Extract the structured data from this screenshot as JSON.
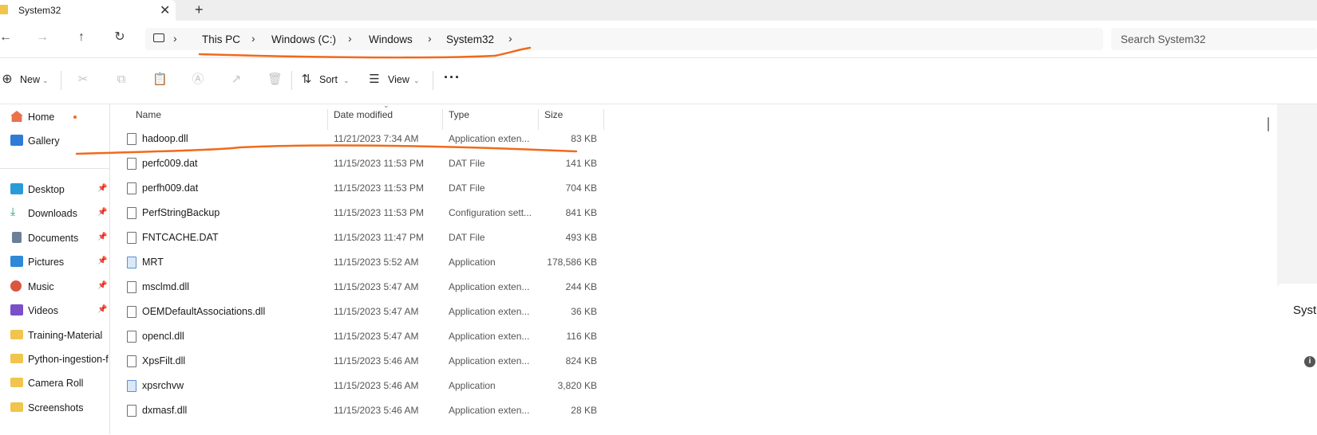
{
  "tab": {
    "title": "System32",
    "close": "✕",
    "new_tab": "+"
  },
  "nav": {
    "back": "←",
    "forward": "→",
    "up": "↑",
    "refresh": "↻",
    "breadcrumbs": [
      "This PC",
      "Windows (C:)",
      "Windows",
      "System32"
    ],
    "search_placeholder": "Search System32"
  },
  "commands": {
    "new_label": "New",
    "sort_label": "Sort",
    "view_label": "View",
    "more": "···"
  },
  "sidebar": {
    "items": [
      {
        "label": "Home",
        "icon": "home-icon"
      },
      {
        "label": "Gallery",
        "icon": "gallery-icon"
      },
      {
        "label": "Desktop",
        "icon": "desktop-icon",
        "pinned": true
      },
      {
        "label": "Downloads",
        "icon": "download-icon",
        "pinned": true
      },
      {
        "label": "Documents",
        "icon": "documents-icon",
        "pinned": true
      },
      {
        "label": "Pictures",
        "icon": "pictures-icon",
        "pinned": true
      },
      {
        "label": "Music",
        "icon": "music-icon",
        "pinned": true
      },
      {
        "label": "Videos",
        "icon": "videos-icon",
        "pinned": true
      },
      {
        "label": "Training-Material",
        "icon": "folder-icon"
      },
      {
        "label": "Python-ingestion-f",
        "icon": "folder-icon"
      },
      {
        "label": "Camera Roll",
        "icon": "folder-icon"
      },
      {
        "label": "Screenshots",
        "icon": "folder-icon"
      }
    ]
  },
  "columns": {
    "name": "Name",
    "date": "Date modified",
    "type": "Type",
    "size": "Size"
  },
  "files": [
    {
      "name": "hadoop.dll",
      "date": "11/21/2023 7:34 AM",
      "type": "Application exten...",
      "size": "83 KB",
      "icon": "dll-file-icon"
    },
    {
      "name": "perfc009.dat",
      "date": "11/15/2023 11:53 PM",
      "type": "DAT File",
      "size": "141 KB",
      "icon": "file-icon"
    },
    {
      "name": "perfh009.dat",
      "date": "11/15/2023 11:53 PM",
      "type": "DAT File",
      "size": "704 KB",
      "icon": "file-icon"
    },
    {
      "name": "PerfStringBackup",
      "date": "11/15/2023 11:53 PM",
      "type": "Configuration sett...",
      "size": "841 KB",
      "icon": "config-file-icon"
    },
    {
      "name": "FNTCACHE.DAT",
      "date": "11/15/2023 11:47 PM",
      "type": "DAT File",
      "size": "493 KB",
      "icon": "file-icon"
    },
    {
      "name": "MRT",
      "date": "11/15/2023 5:52 AM",
      "type": "Application",
      "size": "178,586 KB",
      "icon": "app-icon"
    },
    {
      "name": "msclmd.dll",
      "date": "11/15/2023 5:47 AM",
      "type": "Application exten...",
      "size": "244 KB",
      "icon": "dll-file-icon"
    },
    {
      "name": "OEMDefaultAssociations.dll",
      "date": "11/15/2023 5:47 AM",
      "type": "Application exten...",
      "size": "36 KB",
      "icon": "dll-file-icon"
    },
    {
      "name": "opencl.dll",
      "date": "11/15/2023 5:47 AM",
      "type": "Application exten...",
      "size": "116 KB",
      "icon": "dll-file-icon"
    },
    {
      "name": "XpsFilt.dll",
      "date": "11/15/2023 5:46 AM",
      "type": "Application exten...",
      "size": "824 KB",
      "icon": "dll-file-icon"
    },
    {
      "name": "xpsrchvw",
      "date": "11/15/2023 5:46 AM",
      "type": "Application",
      "size": "3,820 KB",
      "icon": "app-icon"
    },
    {
      "name": "dxmasf.dll",
      "date": "11/15/2023 5:46 AM",
      "type": "Application exten...",
      "size": "28 KB",
      "icon": "dll-file-icon"
    }
  ],
  "details_pane": {
    "title": "Syst",
    "info": "i"
  },
  "colors": {
    "annotation": "#f06a1c",
    "folder": "#f1c44d",
    "accent": "#1a6fd0"
  }
}
